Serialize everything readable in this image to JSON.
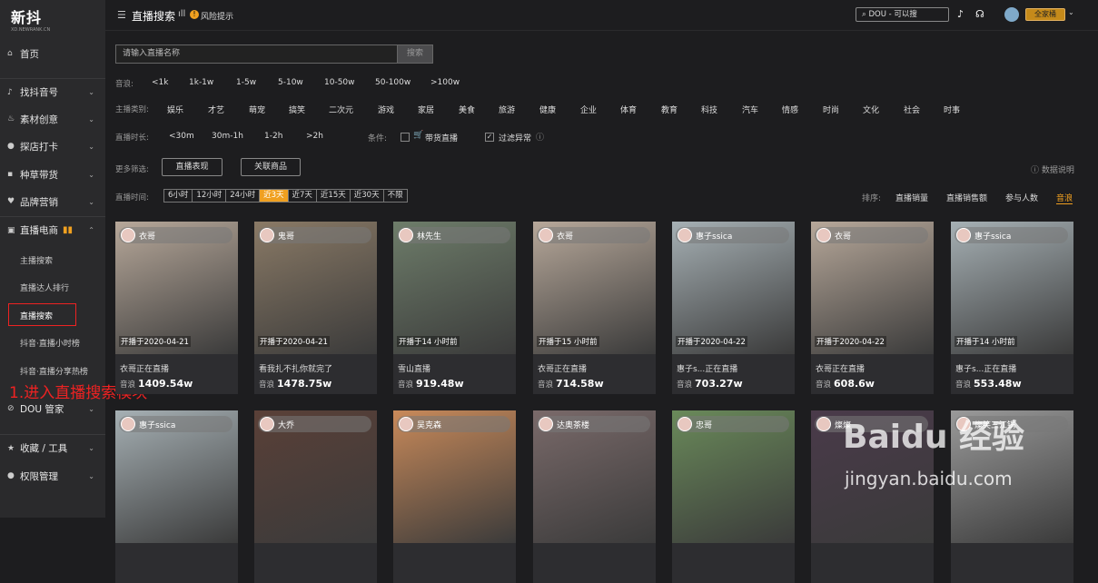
{
  "brand": {
    "name": "新抖",
    "sub": "XD.NEWRANK.CN"
  },
  "sidebar": {
    "items": [
      {
        "label": "首页",
        "icon": "home-icon"
      },
      {
        "label": "找抖音号",
        "icon": "music-note-icon"
      },
      {
        "label": "素材创意",
        "icon": "fire-icon"
      },
      {
        "label": "探店打卡",
        "icon": "pin-icon"
      },
      {
        "label": "种草带货",
        "icon": "cart-icon"
      },
      {
        "label": "品牌营销",
        "icon": "heart-icon"
      },
      {
        "label": "直播电商",
        "icon": "live-icon"
      },
      {
        "label": "DOU 管家",
        "icon": "link-icon"
      },
      {
        "label": "收藏 / 工具",
        "icon": "star-icon"
      },
      {
        "label": "权限管理",
        "icon": "user-icon"
      }
    ],
    "subitems": [
      "主播搜索",
      "直播达人排行",
      "直播搜索",
      "抖音·直播小时榜",
      "抖音·直播分享热榜"
    ]
  },
  "annotation": "1.进入直播搜索模块",
  "header": {
    "title": "直播搜索",
    "risk": "风险提示",
    "search_placeholder": "DOU - 可以搜",
    "plan": "全家桶"
  },
  "search": {
    "placeholder": "请输入直播名称",
    "button": "搜索"
  },
  "filters": {
    "volume_label": "音浪:",
    "volume": [
      "<1k",
      "1k-1w",
      "1-5w",
      "5-10w",
      "10-50w",
      "50-100w",
      ">100w"
    ],
    "category_label": "主播类别:",
    "categories": [
      "娱乐",
      "才艺",
      "萌宠",
      "搞笑",
      "二次元",
      "游戏",
      "家居",
      "美食",
      "旅游",
      "健康",
      "企业",
      "体育",
      "教育",
      "科技",
      "汽车",
      "情感",
      "时尚",
      "文化",
      "社会",
      "时事"
    ],
    "duration_label": "直播时长:",
    "durations": [
      "<30m",
      "30m-1h",
      "1-2h",
      ">2h"
    ],
    "condition_label": "条件:",
    "cond_goods": "带货直播",
    "cond_filter": "过滤异常",
    "more_label": "更多筛选:",
    "more": [
      "直播表现",
      "关联商品"
    ],
    "data_note": "数据说明",
    "time_label": "直播时间:",
    "times": [
      "6小时",
      "12小时",
      "24小时",
      "近3天",
      "近7天",
      "近15天",
      "近30天",
      "不限"
    ],
    "active_time": "近3天",
    "sort_label": "排序:",
    "sorts": [
      "直播销量",
      "直播销售额",
      "参与人数",
      "音浪"
    ]
  },
  "cards": [
    {
      "name": "衣哥",
      "date": "开播于2020-04-21",
      "line": "衣哥正在直播",
      "vlabel": "音浪",
      "value": "1409.54w",
      "color": "#b7a89a"
    },
    {
      "name": "鬼哥",
      "date": "开播于2020-04-21",
      "line": "看我扎不扎你就完了",
      "vlabel": "音浪",
      "value": "1478.75w",
      "color": "#8a7a66"
    },
    {
      "name": "林先生",
      "date": "开播于14 小时前",
      "line": "雪山直播",
      "vlabel": "音浪",
      "value": "919.48w",
      "color": "#6e7d6a"
    },
    {
      "name": "衣哥",
      "date": "开播于15 小时前",
      "line": "衣哥正在直播",
      "vlabel": "音浪",
      "value": "714.58w",
      "color": "#b7a89a"
    },
    {
      "name": "惠子ssica",
      "date": "开播于2020-04-22",
      "line": "惠子s...正在直播",
      "vlabel": "音浪",
      "value": "703.27w",
      "color": "#a6b0b4"
    },
    {
      "name": "衣哥",
      "date": "开播于2020-04-22",
      "line": "衣哥正在直播",
      "vlabel": "音浪",
      "value": "608.6w",
      "color": "#b7a89a"
    },
    {
      "name": "惠子ssica",
      "date": "开播于14 小时前",
      "line": "惠子s...正在直播",
      "vlabel": "音浪",
      "value": "553.48w",
      "color": "#a6b0b4"
    },
    {
      "name": "惠子ssica",
      "color": "#a6b0b4"
    },
    {
      "name": "大乔",
      "color": "#5a4038"
    },
    {
      "name": "吴克森",
      "color": "#c98a5a"
    },
    {
      "name": "达奥茶楼",
      "color": "#7a6a6a"
    },
    {
      "name": "忠哥",
      "color": "#6a8a5a"
    },
    {
      "name": "燦燦",
      "color": "#4a3a4a"
    },
    {
      "name": "燦笑三江锅",
      "color": "#9a9a9a"
    }
  ],
  "watermark": {
    "brand": "Baidu 经验",
    "url": "jingyan.baidu.com"
  }
}
